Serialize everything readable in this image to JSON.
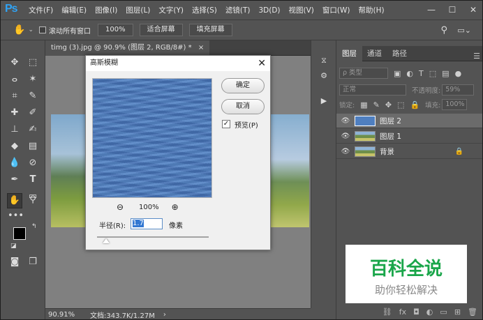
{
  "app": {
    "logo": "Ps"
  },
  "menu": [
    "文件(F)",
    "编辑(E)",
    "图像(I)",
    "图层(L)",
    "文字(Y)",
    "选择(S)",
    "滤镜(T)",
    "3D(D)",
    "视图(V)",
    "窗口(W)",
    "帮助(H)"
  ],
  "window_controls": [
    "—",
    "☐",
    "✕"
  ],
  "options": {
    "scroll_all_windows": "滚动所有窗口",
    "zoom_100": "100%",
    "fit_screen": "适合屏幕",
    "fill_screen": "填充屏幕"
  },
  "document": {
    "tab": "timg (3).jpg @ 90.9% (图层 2, RGB/8#) *",
    "tab_close": "×",
    "zoom": "90.91%",
    "doc_size": "文档:343.7K/1.27M"
  },
  "dialog": {
    "title": "高斯模糊",
    "ok": "确定",
    "cancel": "取消",
    "preview_label": "预览(P)",
    "preview_checked": true,
    "zoom": "100%",
    "radius_label": "半径(R):",
    "radius_value": "1.7",
    "radius_unit": "像素"
  },
  "panel": {
    "tabs": [
      "图层",
      "通道",
      "路径"
    ],
    "filter_kind": "ρ 类型",
    "blend_mode": "正常",
    "opacity_label": "不透明度:",
    "opacity_value": "59%",
    "lock_label": "锁定:",
    "fill_label": "填充:",
    "fill_value": "100%",
    "layers": [
      {
        "name": "图层 2",
        "selected": true,
        "locked": false
      },
      {
        "name": "图层 1",
        "selected": false,
        "locked": false
      },
      {
        "name": "背景",
        "selected": false,
        "locked": true
      }
    ]
  },
  "watermark": {
    "title": "百科全说",
    "subtitle": "助你轻松解决"
  }
}
